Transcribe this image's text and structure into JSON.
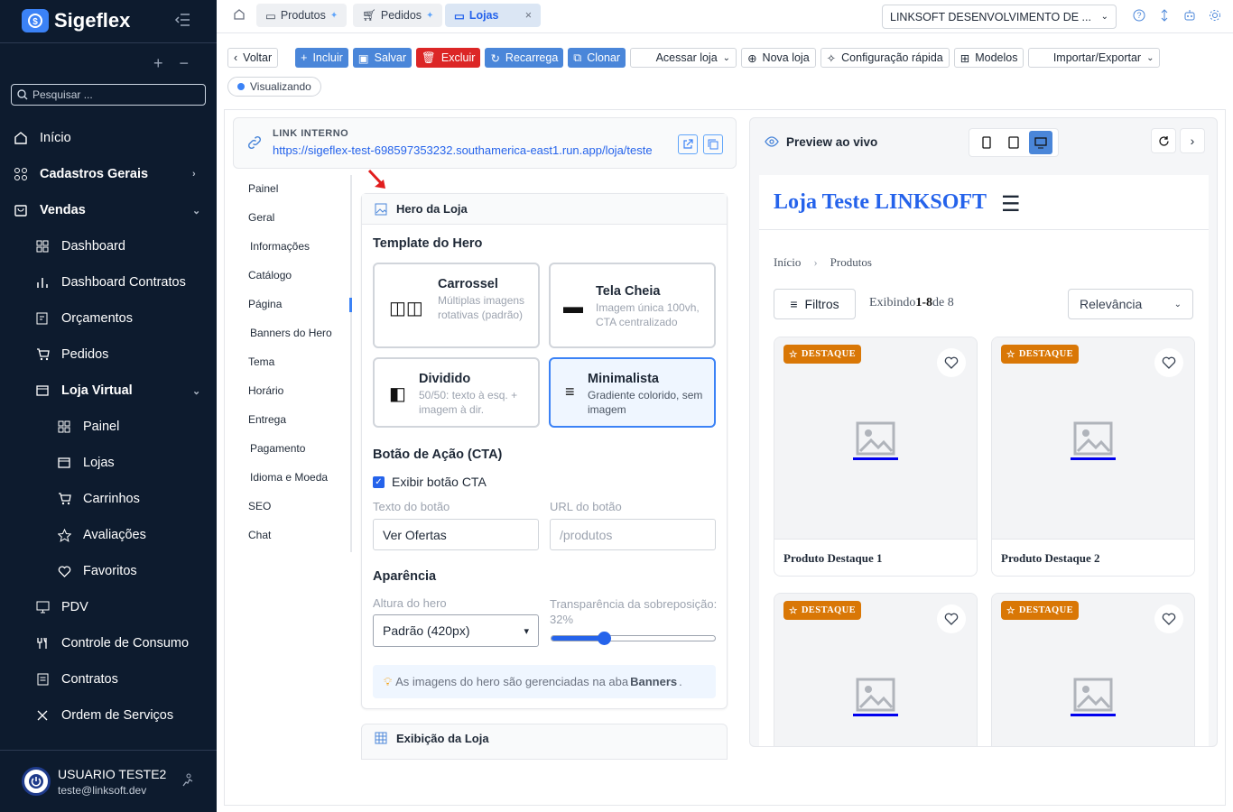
{
  "app": {
    "name": "Sigeflex"
  },
  "sidebar": {
    "search_placeholder": "Pesquisar ...",
    "items": [
      {
        "label": "Início",
        "icon": "home-icon"
      },
      {
        "label": "Cadastros Gerais",
        "icon": "grid-icon"
      },
      {
        "label": "Vendas",
        "icon": "shopping-bag-icon"
      },
      {
        "label": "Dashboard",
        "icon": "dashboard-icon"
      },
      {
        "label": "Dashboard Contratos",
        "icon": "bar-chart-icon"
      },
      {
        "label": "Orçamentos",
        "icon": "edit-doc-icon"
      },
      {
        "label": "Pedidos",
        "icon": "cart-icon"
      },
      {
        "label": "Loja Virtual",
        "icon": "store-icon"
      },
      {
        "label": "Painel",
        "icon": "dashboard-icon"
      },
      {
        "label": "Lojas",
        "icon": "store-icon"
      },
      {
        "label": "Carrinhos",
        "icon": "cart-icon"
      },
      {
        "label": "Avaliações",
        "icon": "star-icon"
      },
      {
        "label": "Favoritos",
        "icon": "heart-icon"
      },
      {
        "label": "PDV",
        "icon": "monitor-icon"
      },
      {
        "label": "Controle de Consumo",
        "icon": "utensils-icon"
      },
      {
        "label": "Contratos",
        "icon": "document-icon"
      },
      {
        "label": "Ordem de Serviços",
        "icon": "tools-icon"
      }
    ],
    "user": {
      "name": "USUARIO TESTE2",
      "email": "teste@linksoft.dev"
    }
  },
  "tabs": [
    {
      "label": "Produtos"
    },
    {
      "label": "Pedidos"
    },
    {
      "label": "Lojas"
    }
  ],
  "company_select": "LINKSOFT DESENVOLVIMENTO DE ...",
  "toolbar": {
    "back": "Voltar",
    "add": "Incluir",
    "save": "Salvar",
    "delete": "Excluir",
    "reload": "Recarrega",
    "clone": "Clonar",
    "access_store": "Acessar loja",
    "new_store": "Nova loja",
    "quick_config": "Configuração rápida",
    "models": "Modelos",
    "import_export": "Importar/Exportar"
  },
  "status": "Visualizando",
  "link": {
    "label": "LINK INTERNO",
    "url": "https://sigeflex-test-698597353232.southamerica-east1.run.app/loja/teste"
  },
  "side_tabs": [
    "Painel",
    "Geral",
    "Informações",
    "Catálogo",
    "Página",
    "Banners do Hero",
    "Tema",
    "Horário",
    "Entrega",
    "Pagamento",
    "Idioma e Moeda",
    "SEO",
    "Chat"
  ],
  "hero": {
    "title": "Hero da Loja",
    "template_title": "Template do Hero",
    "templates": [
      {
        "name": "Carrossel",
        "desc": "Múltiplas imagens rotativas (padrão)",
        "glyph": "◫◫"
      },
      {
        "name": "Tela Cheia",
        "desc": "Imagem única 100vh, CTA centralizado",
        "glyph": "▬"
      },
      {
        "name": "Dividido",
        "desc": "50/50: texto à esq. + imagem à dir.",
        "glyph": "◧"
      },
      {
        "name": "Minimalista",
        "desc": "Gradiente colorido, sem imagem",
        "glyph": "≡"
      }
    ],
    "cta_title": "Botão de Ação (CTA)",
    "cta_checkbox": "Exibir botão CTA",
    "btn_text_label": "Texto do botão",
    "btn_text_value": "Ver Ofertas",
    "btn_url_label": "URL do botão",
    "btn_url_placeholder": "/produtos",
    "appearance_title": "Aparência",
    "height_label": "Altura do hero",
    "height_value": "Padrão (420px)",
    "overlay_label": "Transparência da sobreposição: 32%",
    "overlay_value": 0.32,
    "hint_pre": "As imagens do hero são gerenciadas na aba",
    "hint_bold": "Banners",
    "hint_post": "."
  },
  "display_section": "Exibição da Loja",
  "preview": {
    "title": "Preview ao vivo",
    "store_name": "Loja Teste LINKSOFT",
    "breadcrumb": [
      "Início",
      "Produtos"
    ],
    "filter": "Filtros",
    "showing_pre": "Exibindo",
    "showing_range": "1-8",
    "showing_post": "de 8",
    "sort": "Relevância",
    "badge": "DESTAQUE",
    "products": [
      "Produto Destaque 1",
      "Produto Destaque 2",
      "",
      ""
    ]
  }
}
